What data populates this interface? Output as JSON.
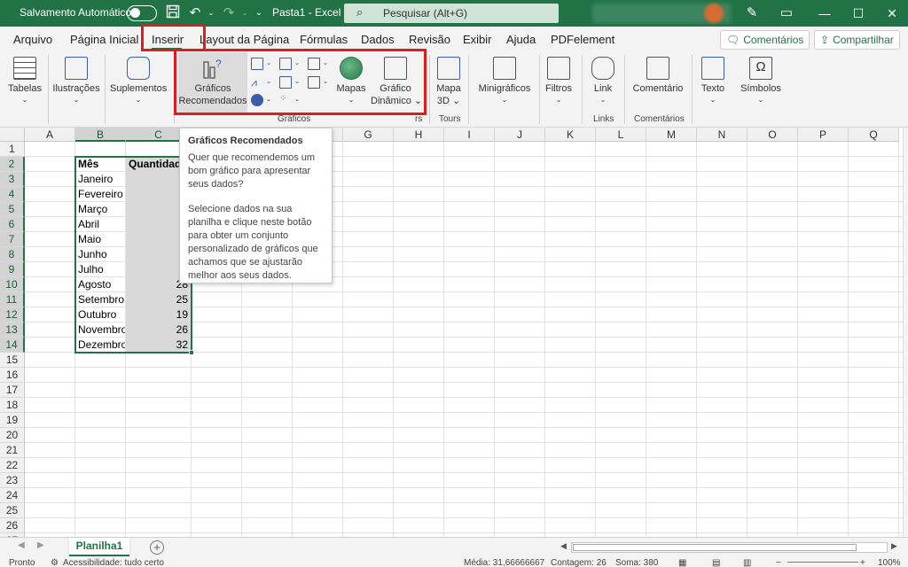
{
  "titlebar": {
    "autosave_label": "Salvamento Automático",
    "document": "Pasta1",
    "app": "Excel",
    "separator": "-",
    "search_placeholder": "Pesquisar (Alt+G)"
  },
  "tabs": [
    "Arquivo",
    "Página Inicial",
    "Inserir",
    "Layout da Página",
    "Fórmulas",
    "Dados",
    "Revisão",
    "Exibir",
    "Ajuda",
    "PDFelement"
  ],
  "active_tab": "Inserir",
  "right_buttons": {
    "comments": "Comentários",
    "share": "Compartilhar"
  },
  "ribbon": {
    "tables": "Tabelas",
    "illustrations": "Ilustrações",
    "addins": "Suplementos",
    "recommended_charts_line1": "Gráficos",
    "recommended_charts_line2": "Recomendados",
    "maps": "Mapas",
    "pivot_chart_line1": "Gráfico",
    "pivot_chart_line2": "Dinâmico",
    "map3d_line1": "Mapa",
    "map3d_line2": "3D",
    "sparklines": "Minigráficos",
    "filters": "Filtros",
    "link": "Link",
    "comment": "Comentário",
    "text": "Texto",
    "symbols": "Símbolos",
    "group_charts": "Gráficos",
    "group_tours": "Tours",
    "group_links": "Links",
    "group_comments": "Comentários",
    "group_charts_launcher": "rs"
  },
  "tooltip": {
    "title": "Gráficos Recomendados",
    "p1": "Quer que recomendemos um bom gráfico para apresentar seus dados?",
    "p2": "Selecione dados na sua planilha e clique neste botão para obter um conjunto personalizado de gráficos que achamos que se ajustarão melhor aos seus dados."
  },
  "grid": {
    "columns": [
      "A",
      "B",
      "C",
      "D",
      "E",
      "F",
      "G",
      "H",
      "I",
      "J",
      "K",
      "L",
      "M",
      "N",
      "O",
      "P",
      "Q"
    ],
    "rows": [
      "1",
      "2",
      "3",
      "4",
      "5",
      "6",
      "7",
      "8",
      "9",
      "10",
      "11",
      "12",
      "13",
      "14",
      "15",
      "16",
      "17",
      "18",
      "19",
      "20",
      "21",
      "22",
      "23",
      "24",
      "25",
      "26",
      "27"
    ],
    "header_month": "Mês",
    "header_quantity": "Quantidad",
    "months": [
      "Janeiro",
      "Fevereiro",
      "Março",
      "Abril",
      "Maio",
      "Junho",
      "Julho",
      "Agosto",
      "Setembro",
      "Outubro",
      "Novembro",
      "Dezembro"
    ],
    "quantities": [
      "",
      "",
      "",
      "",
      "",
      "",
      "",
      "28",
      "25",
      "19",
      "26",
      "32"
    ]
  },
  "sheet": {
    "tab": "Planilha1",
    "add": "+"
  },
  "status": {
    "ready": "Pronto",
    "accessibility": "Acessibilidade: tudo certo",
    "average": "Média: 31,66666667",
    "count": "Contagem: 26",
    "sum": "Soma: 380",
    "zoom": "100%"
  },
  "colors": {
    "excel_green": "#217346",
    "highlight_red": "#e11a1a"
  }
}
